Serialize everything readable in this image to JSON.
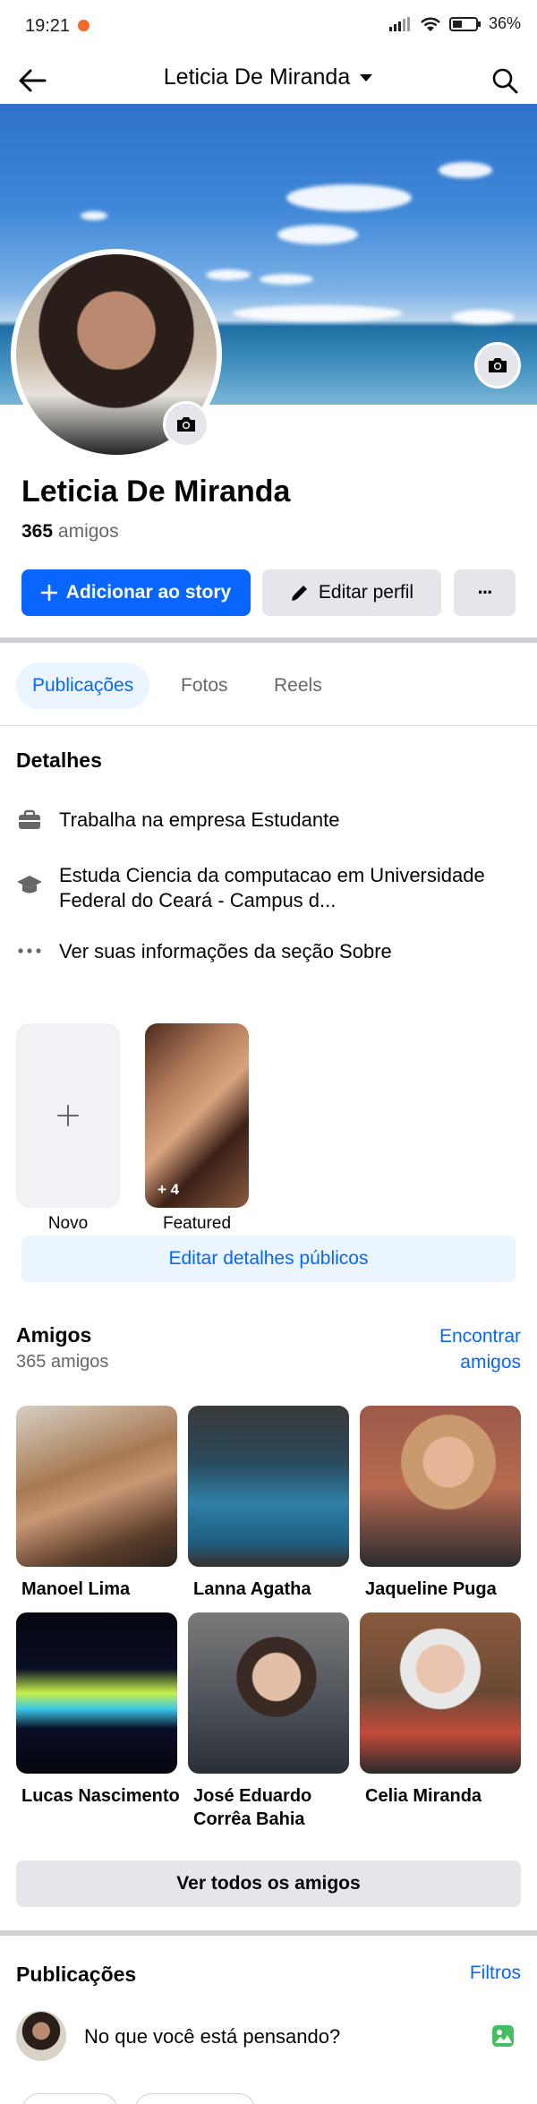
{
  "status_bar": {
    "time": "19:21",
    "battery": "36%"
  },
  "header": {
    "title": "Leticia De Miranda"
  },
  "profile": {
    "name": "Leticia De Miranda",
    "friends_count": "365",
    "friends_word": "amigos"
  },
  "actions": {
    "add_story": "Adicionar ao story",
    "edit_profile": "Editar perfil",
    "more": "···"
  },
  "tabs": [
    "Publicações",
    "Fotos",
    "Reels"
  ],
  "details": {
    "title": "Detalhes",
    "work": "Trabalha na empresa Estudante",
    "study": "Estuda Ciencia da computacao em Universidade Federal do Ceará - Campus d...",
    "about": "Ver suas informações da seção Sobre"
  },
  "featured": {
    "new_label": "Novo",
    "featured_label": "Featured",
    "featured_count": "+ 4",
    "edit_public": "Editar detalhes públicos"
  },
  "friends": {
    "title": "Amigos",
    "count_text": "365 amigos",
    "find_line1": "Encontrar",
    "find_line2": "amigos",
    "list": [
      {
        "name": "Manoel Lima"
      },
      {
        "name": "Lanna Agatha"
      },
      {
        "name": "Jaqueline Puga"
      },
      {
        "name": "Lucas Nascimento"
      },
      {
        "name": "José Eduardo Corrêa Bahia"
      },
      {
        "name": "Celia Miranda"
      }
    ],
    "see_all": "Ver todos os amigos"
  },
  "posts": {
    "title": "Publicações",
    "filters": "Filtros",
    "composer_placeholder": "No que você está pensando?"
  },
  "colors": {
    "accent": "#0866ff",
    "accent_light": "#ebf5ff",
    "gray_button": "#e4e6eb"
  },
  "icons": [
    "back-arrow-icon",
    "caret-down-icon",
    "search-icon",
    "camera-icon",
    "plus-icon",
    "pencil-icon",
    "briefcase-icon",
    "graduation-cap-icon",
    "ellipsis-icon",
    "photo-icon"
  ]
}
